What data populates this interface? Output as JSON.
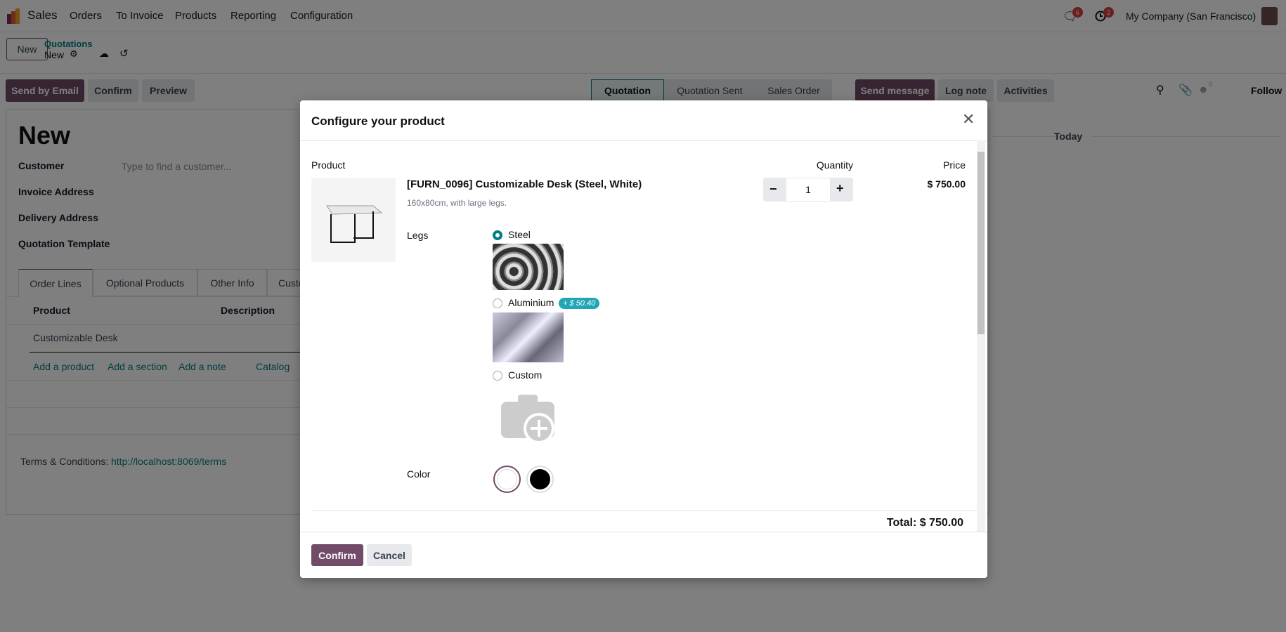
{
  "navbar": {
    "app": "Sales",
    "menu": [
      "Orders",
      "To Invoice",
      "Products",
      "Reporting",
      "Configuration"
    ],
    "messages_count": "6",
    "activities_count": "2",
    "company": "My Company (San Francisco)"
  },
  "control": {
    "new_label": "New",
    "breadcrumb_parent": "Quotations",
    "breadcrumb_current": "New"
  },
  "actions": {
    "send_email": "Send by Email",
    "confirm": "Confirm",
    "preview": "Preview"
  },
  "status": [
    "Quotation",
    "Quotation Sent",
    "Sales Order"
  ],
  "chatter": {
    "send_message": "Send message",
    "log_note": "Log note",
    "activities": "Activities",
    "followers": "0",
    "follow": "Follow",
    "today": "Today"
  },
  "form": {
    "title": "New",
    "customer_label": "Customer",
    "customer_placeholder": "Type to find a customer...",
    "invoice_label": "Invoice Address",
    "delivery_label": "Delivery Address",
    "template_label": "Quotation Template",
    "tabs": [
      "Order Lines",
      "Optional Products",
      "Other Info",
      "Customer Signature"
    ],
    "columns": [
      "Product",
      "Description"
    ],
    "row_product": "Customizable Desk",
    "add_links": [
      "Add a product",
      "Add a section",
      "Add a note",
      "Catalog"
    ],
    "terms_label": "Terms & Conditions:",
    "terms_url": "http://localhost:8069/terms"
  },
  "modal": {
    "title": "Configure your product",
    "col_product": "Product",
    "col_quantity": "Quantity",
    "col_price": "Price",
    "product_name": "[FURN_0096] Customizable Desk (Steel, White)",
    "product_desc": "160x80cm, with large legs.",
    "quantity": "1",
    "price": "$ 750.00",
    "legs_label": "Legs",
    "legs_options": [
      {
        "label": "Steel",
        "selected": true
      },
      {
        "label": "Aluminium",
        "extra": "+ $ 50.40",
        "selected": false
      },
      {
        "label": "Custom",
        "selected": false
      }
    ],
    "color_label": "Color",
    "colors": [
      {
        "name": "White",
        "hex": "#ffffff",
        "selected": true
      },
      {
        "name": "Black",
        "hex": "#000000",
        "selected": false
      }
    ],
    "total": "Total: $ 750.00",
    "confirm": "Confirm",
    "cancel": "Cancel"
  },
  "colors": {
    "brand": "#714b67",
    "link": "#017e84",
    "badge": "#d23f3a"
  }
}
